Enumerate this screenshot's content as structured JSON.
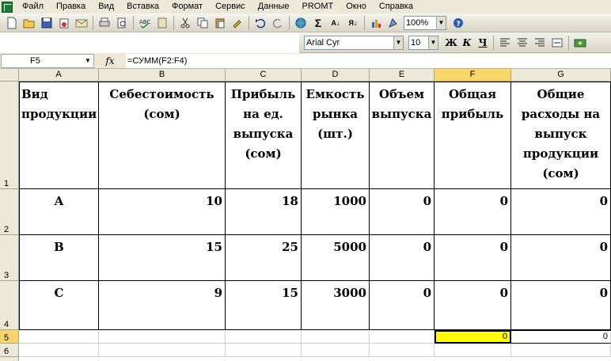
{
  "menubar": {
    "items": [
      {
        "label": "Файл"
      },
      {
        "label": "Правка"
      },
      {
        "label": "Вид"
      },
      {
        "label": "Вставка"
      },
      {
        "label": "Формат"
      },
      {
        "label": "Сервис"
      },
      {
        "label": "Данные"
      },
      {
        "label": "PROMT"
      },
      {
        "label": "Окно"
      },
      {
        "label": "Справка"
      }
    ]
  },
  "toolbar": {
    "zoom": "100%",
    "icons": [
      "new-icon",
      "open-icon",
      "save-icon",
      "permission-icon",
      "email-icon",
      "print-icon",
      "print-preview-icon",
      "spelling-icon",
      "research-icon",
      "cut-icon",
      "copy-icon",
      "paste-icon",
      "format-painter-icon",
      "undo-icon",
      "redo-icon",
      "hyperlink-icon",
      "autosum-icon",
      "sort-ascending-icon",
      "sort-descending-icon",
      "chart-wizard-icon",
      "drawing-icon",
      "help-icon"
    ]
  },
  "format_toolbar": {
    "font": "Arial Cyr",
    "size": "10",
    "bold": "Ж",
    "italic": "К",
    "underline": "Ч"
  },
  "formula_bar": {
    "name_box": "F5",
    "fx": "fx",
    "formula": "=СУММ(F2:F4)"
  },
  "columns": [
    "A",
    "B",
    "C",
    "D",
    "E",
    "F",
    "G"
  ],
  "rows": [
    "1",
    "2",
    "3",
    "4",
    "5",
    "6"
  ],
  "headers": {
    "A": "Вид продукции",
    "B": "Себестоимость (сом)",
    "C": "Прибыль на ед. выпуска (сом)",
    "D": "Емкость рынка (шт.)",
    "E": "Объем выпуска",
    "F": "Общая прибыль",
    "G": "Общие расходы на выпуск продукции (сом)"
  },
  "table": [
    {
      "A": "A",
      "B": "10",
      "C": "18",
      "D": "1000",
      "E": "0",
      "F": "0",
      "G": "0"
    },
    {
      "A": "B",
      "B": "15",
      "C": "25",
      "D": "5000",
      "E": "0",
      "F": "0",
      "G": "0"
    },
    {
      "A": "C",
      "B": "9",
      "C": "15",
      "D": "3000",
      "E": "0",
      "F": "0",
      "G": "0"
    }
  ],
  "totals": {
    "F": "0",
    "G": "0"
  },
  "colors": {
    "active_cell": "#ffff00",
    "selected_header": "#f8d66a"
  }
}
